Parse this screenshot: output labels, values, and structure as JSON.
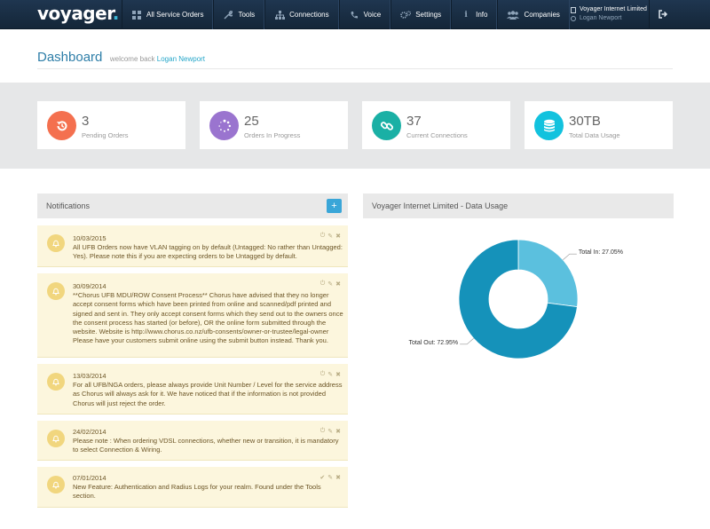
{
  "app": {
    "logo": "voyager",
    "logo_dot": "."
  },
  "nav": [
    {
      "label": "All Service Orders",
      "icon": "grid-icon",
      "glyph": "▦"
    },
    {
      "label": "Tools",
      "icon": "wrench-icon",
      "glyph": "🔧"
    },
    {
      "label": "Connections",
      "icon": "sitemap-icon",
      "glyph": "⊞"
    },
    {
      "label": "Voice",
      "icon": "phone-icon",
      "glyph": "✆"
    },
    {
      "label": "Settings",
      "icon": "gears-icon",
      "glyph": "⚙"
    },
    {
      "label": "Info",
      "icon": "info-icon",
      "glyph": "i"
    },
    {
      "label": "Companies",
      "icon": "users-icon",
      "glyph": "👥"
    }
  ],
  "account": {
    "company": "Voyager Internet Limited",
    "user": "Logan Newport"
  },
  "header": {
    "title": "Dashboard",
    "welcome": "welcome back",
    "user": "Logan Newport"
  },
  "stats": [
    {
      "value": "3",
      "label": "Pending Orders",
      "icon": "refresh-icon",
      "color": "#f4704f"
    },
    {
      "value": "25",
      "label": "Orders In Progress",
      "icon": "spinner-icon",
      "color": "#9a74cf"
    },
    {
      "value": "37",
      "label": "Current Connections",
      "icon": "link-icon",
      "color": "#1ab0a5"
    },
    {
      "value": "30TB",
      "label": "Total Data Usage",
      "icon": "database-icon",
      "color": "#12c2de"
    }
  ],
  "notifications_panel": {
    "title": "Notifications",
    "add_label": "+"
  },
  "notifications": [
    {
      "date": "10/03/2015",
      "text": "All UFB Orders now have VLAN tagging on by default (Untagged: No rather than Untagged: Yes). Please note this if you are expecting orders to be Untagged by default."
    },
    {
      "date": "30/09/2014",
      "text": "**Chorus UFB MDU/ROW Consent Process** Chorus have advised that they no longer accept consent forms which have been printed from online and scanned/pdf printed and signed and sent in. They only accept consent forms which they send out to the owners once the consent process has started (or before), OR the online form submitted through the website. Website is http://www.chorus.co.nz/ufb-consents/owner-or-trustee/legal-owner Please have your customers submit online using the submit button instead. Thank you."
    },
    {
      "date": "13/03/2014",
      "text": "For all UFB/NGA orders, please always provide Unit Number / Level for the service address as Chorus will always ask for it. We have noticed that if the information is not provided Chorus will just reject the order."
    },
    {
      "date": "24/02/2014",
      "text": "Please note : When ordering VDSL connections, whether new or transition, it is mandatory to select Connection & Wiring."
    },
    {
      "date": "07/01/2014",
      "text": "New Feature: Authentication and Radius Logs for your realm. Found under the Tools section."
    }
  ],
  "usage_panel": {
    "title": "Voyager Internet Limited - Data Usage"
  },
  "chart_data": {
    "type": "pie",
    "donut": true,
    "title": "",
    "categories": [
      "Total In",
      "Total Out"
    ],
    "values": [
      27.05,
      72.95
    ],
    "labels": [
      "Total In: 27.05%",
      "Total Out: 72.95%"
    ],
    "colors": [
      "#5bc0de",
      "#1592ba"
    ],
    "legend": "none"
  }
}
